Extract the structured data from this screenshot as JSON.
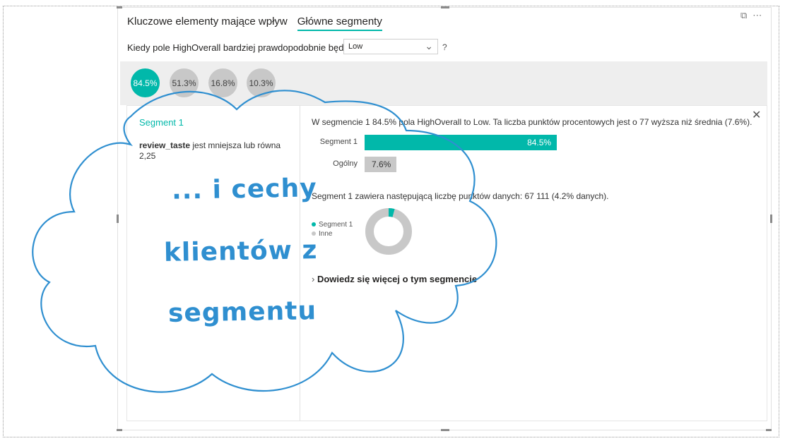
{
  "tabs": [
    {
      "label": "Kluczowe elementy mające wpływ",
      "active": false
    },
    {
      "label": "Główne segmenty",
      "active": true
    }
  ],
  "question": {
    "text": "Kiedy pole HighOverall bardziej prawdopodobnie będzie",
    "dropdown_value": "Low",
    "help": "?"
  },
  "segments": [
    {
      "label": "84.5%",
      "active": true
    },
    {
      "label": "51.3%",
      "active": false
    },
    {
      "label": "16.8%",
      "active": false
    },
    {
      "label": "10.3%",
      "active": false
    }
  ],
  "detail": {
    "segment_title": "Segment 1",
    "condition_field": "review_taste",
    "condition_text": " jest mniejsza lub równa",
    "condition_value": "2,25",
    "summary": "W segmencie 1 84.5% pola HighOverall to Low. Ta liczba punktów procentowych jest o 77 wyższa niż średnia (7.6%).",
    "count_text": "Segment 1 zawiera następującą liczbę punktów danych: 67 111 (4.2% danych).",
    "learn_more": "Dowiedz się więcej o tym segmencie"
  },
  "chart_data": {
    "type": "bar",
    "categories": [
      "Segment 1",
      "Ogólny"
    ],
    "values": [
      84.5,
      7.6
    ],
    "value_labels": [
      "84.5%",
      "7.6%"
    ],
    "colors": [
      "#01b8aa",
      "#c8c8c8"
    ],
    "xlim": [
      0,
      100
    ]
  },
  "donut": {
    "legend": [
      "Segment 1",
      "Inne"
    ],
    "values": [
      4.2,
      95.8
    ],
    "colors": [
      "#01b8aa",
      "#c8c8c8"
    ]
  },
  "annotation": {
    "lines": [
      "... i cechy",
      "klientów z",
      "segmentu"
    ],
    "color": "#2f8fd0"
  },
  "colors": {
    "accent": "#01b8aa",
    "muted": "#c8c8c8"
  }
}
